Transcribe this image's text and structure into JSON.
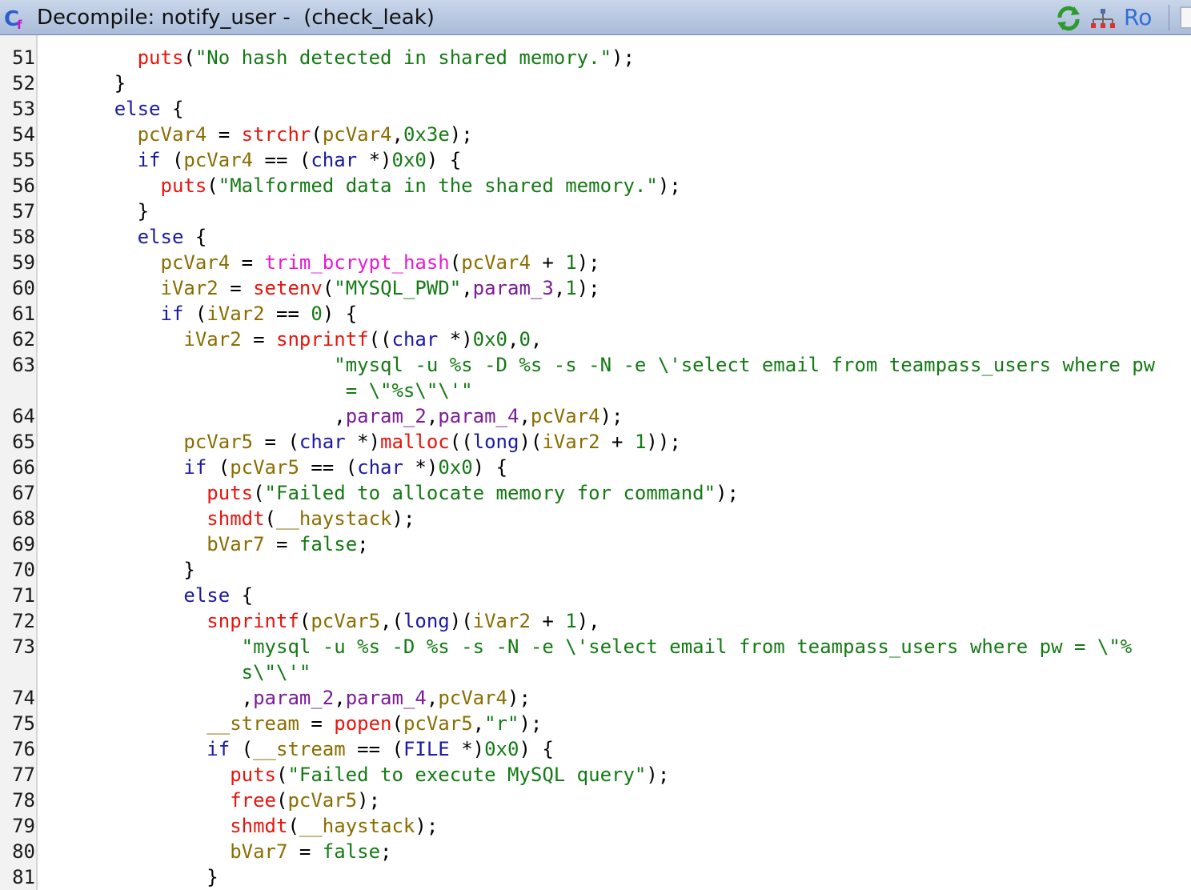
{
  "window": {
    "title": "Decompile: notify_user -  (check_leak)",
    "ro_label": "Ro",
    "icons": [
      "decompiler-app-icon",
      "refresh-icon",
      "graph-icon"
    ]
  },
  "colors": {
    "keyword": "#1a1aa6",
    "function_call": "#e8140c",
    "variable": "#8a6d00",
    "string": "#147a14",
    "number": "#147a14",
    "parameter": "#7b1c99",
    "special_function": "#e81ad0",
    "plain": "#000000"
  },
  "code_lines": [
    {
      "n": "51",
      "i": 4,
      "t": [
        [
          "f",
          "puts"
        ],
        [
          "p",
          "("
        ],
        [
          "s",
          "\"No hash detected in shared memory.\""
        ],
        [
          "p",
          ");"
        ]
      ]
    },
    {
      "n": "52",
      "i": 3,
      "t": [
        [
          "p",
          "}"
        ]
      ]
    },
    {
      "n": "53",
      "i": 3,
      "t": [
        [
          "k",
          "else"
        ],
        [
          "p",
          " {"
        ]
      ]
    },
    {
      "n": "54",
      "i": 4,
      "t": [
        [
          "v",
          "pcVar4"
        ],
        [
          "p",
          " = "
        ],
        [
          "f",
          "strchr"
        ],
        [
          "p",
          "("
        ],
        [
          "v",
          "pcVar4"
        ],
        [
          "p",
          ","
        ],
        [
          "num",
          "0x3e"
        ],
        [
          "p",
          ");"
        ]
      ]
    },
    {
      "n": "55",
      "i": 4,
      "t": [
        [
          "k",
          "if"
        ],
        [
          "p",
          " ("
        ],
        [
          "v",
          "pcVar4"
        ],
        [
          "p",
          " == ("
        ],
        [
          "k",
          "char"
        ],
        [
          "p",
          " *)"
        ],
        [
          "num",
          "0x0"
        ],
        [
          "p",
          ") {"
        ]
      ]
    },
    {
      "n": "56",
      "i": 5,
      "t": [
        [
          "f",
          "puts"
        ],
        [
          "p",
          "("
        ],
        [
          "s",
          "\"Malformed data in the shared memory.\""
        ],
        [
          "p",
          ");"
        ]
      ]
    },
    {
      "n": "57",
      "i": 4,
      "t": [
        [
          "p",
          "}"
        ]
      ]
    },
    {
      "n": "58",
      "i": 4,
      "t": [
        [
          "k",
          "else"
        ],
        [
          "p",
          " {"
        ]
      ]
    },
    {
      "n": "59",
      "i": 5,
      "t": [
        [
          "v",
          "pcVar4"
        ],
        [
          "p",
          " = "
        ],
        [
          "m",
          "trim_bcrypt_hash"
        ],
        [
          "p",
          "("
        ],
        [
          "v",
          "pcVar4"
        ],
        [
          "p",
          " + "
        ],
        [
          "num",
          "1"
        ],
        [
          "p",
          ");"
        ]
      ]
    },
    {
      "n": "60",
      "i": 5,
      "t": [
        [
          "v",
          "iVar2"
        ],
        [
          "p",
          " = "
        ],
        [
          "f",
          "setenv"
        ],
        [
          "p",
          "("
        ],
        [
          "s",
          "\"MYSQL_PWD\""
        ],
        [
          "p",
          ","
        ],
        [
          "a",
          "param_3"
        ],
        [
          "p",
          ","
        ],
        [
          "num",
          "1"
        ],
        [
          "p",
          ");"
        ]
      ]
    },
    {
      "n": "61",
      "i": 5,
      "t": [
        [
          "k",
          "if"
        ],
        [
          "p",
          " ("
        ],
        [
          "v",
          "iVar2"
        ],
        [
          "p",
          " == "
        ],
        [
          "num",
          "0"
        ],
        [
          "p",
          ") {"
        ]
      ]
    },
    {
      "n": "62",
      "i": 6,
      "t": [
        [
          "v",
          "iVar2"
        ],
        [
          "p",
          " = "
        ],
        [
          "f",
          "snprintf"
        ],
        [
          "p",
          "(("
        ],
        [
          "k",
          "char"
        ],
        [
          "p",
          " *)"
        ],
        [
          "num",
          "0x0"
        ],
        [
          "p",
          ","
        ],
        [
          "num",
          "0"
        ],
        [
          "p",
          ","
        ]
      ]
    },
    {
      "n": "63",
      "i": 0,
      "pad": "                         ",
      "t": [
        [
          "s",
          "\"mysql -u %s -D %s -s -N -e \\'select email from teampass_users where pw"
        ]
      ]
    },
    {
      "n": "",
      "i": 0,
      "pad": "                          ",
      "t": [
        [
          "s",
          "= \\\"%s\\\"\\'\""
        ]
      ]
    },
    {
      "n": "64",
      "i": 0,
      "pad": "                         ",
      "t": [
        [
          "p",
          ","
        ],
        [
          "a",
          "param_2"
        ],
        [
          "p",
          ","
        ],
        [
          "a",
          "param_4"
        ],
        [
          "p",
          ","
        ],
        [
          "v",
          "pcVar4"
        ],
        [
          "p",
          ");"
        ]
      ]
    },
    {
      "n": "65",
      "i": 6,
      "t": [
        [
          "v",
          "pcVar5"
        ],
        [
          "p",
          " = ("
        ],
        [
          "k",
          "char"
        ],
        [
          "p",
          " *)"
        ],
        [
          "f",
          "malloc"
        ],
        [
          "p",
          "(("
        ],
        [
          "k",
          "long"
        ],
        [
          "p",
          ")("
        ],
        [
          "v",
          "iVar2"
        ],
        [
          "p",
          " + "
        ],
        [
          "num",
          "1"
        ],
        [
          "p",
          "));"
        ]
      ]
    },
    {
      "n": "66",
      "i": 6,
      "t": [
        [
          "k",
          "if"
        ],
        [
          "p",
          " ("
        ],
        [
          "v",
          "pcVar5"
        ],
        [
          "p",
          " == ("
        ],
        [
          "k",
          "char"
        ],
        [
          "p",
          " *)"
        ],
        [
          "num",
          "0x0"
        ],
        [
          "p",
          ") {"
        ]
      ]
    },
    {
      "n": "67",
      "i": 7,
      "t": [
        [
          "f",
          "puts"
        ],
        [
          "p",
          "("
        ],
        [
          "s",
          "\"Failed to allocate memory for command\""
        ],
        [
          "p",
          ");"
        ]
      ]
    },
    {
      "n": "68",
      "i": 7,
      "t": [
        [
          "f",
          "shmdt"
        ],
        [
          "p",
          "("
        ],
        [
          "v",
          "__haystack"
        ],
        [
          "p",
          ");"
        ]
      ]
    },
    {
      "n": "69",
      "i": 7,
      "t": [
        [
          "v",
          "bVar7"
        ],
        [
          "p",
          " = "
        ],
        [
          "num",
          "false"
        ],
        [
          "p",
          ";"
        ]
      ]
    },
    {
      "n": "70",
      "i": 6,
      "t": [
        [
          "p",
          "}"
        ]
      ]
    },
    {
      "n": "71",
      "i": 6,
      "t": [
        [
          "k",
          "else"
        ],
        [
          "p",
          " {"
        ]
      ]
    },
    {
      "n": "72",
      "i": 7,
      "t": [
        [
          "f",
          "snprintf"
        ],
        [
          "p",
          "("
        ],
        [
          "v",
          "pcVar5"
        ],
        [
          "p",
          ",("
        ],
        [
          "k",
          "long"
        ],
        [
          "p",
          ")("
        ],
        [
          "v",
          "iVar2"
        ],
        [
          "p",
          " + "
        ],
        [
          "num",
          "1"
        ],
        [
          "p",
          "),"
        ]
      ]
    },
    {
      "n": "73",
      "i": 0,
      "pad": "                 ",
      "t": [
        [
          "s",
          "\"mysql -u %s -D %s -s -N -e \\'select email from teampass_users where pw = \\\"%"
        ]
      ]
    },
    {
      "n": "",
      "i": 0,
      "pad": "                 ",
      "t": [
        [
          "s",
          "s\\\"\\'\""
        ]
      ]
    },
    {
      "n": "74",
      "i": 0,
      "pad": "                 ",
      "t": [
        [
          "p",
          ","
        ],
        [
          "a",
          "param_2"
        ],
        [
          "p",
          ","
        ],
        [
          "a",
          "param_4"
        ],
        [
          "p",
          ","
        ],
        [
          "v",
          "pcVar4"
        ],
        [
          "p",
          ");"
        ]
      ]
    },
    {
      "n": "75",
      "i": 7,
      "t": [
        [
          "v",
          "__stream"
        ],
        [
          "p",
          " = "
        ],
        [
          "f",
          "popen"
        ],
        [
          "p",
          "("
        ],
        [
          "v",
          "pcVar5"
        ],
        [
          "p",
          ","
        ],
        [
          "s",
          "\"r\""
        ],
        [
          "p",
          ");"
        ]
      ]
    },
    {
      "n": "76",
      "i": 7,
      "t": [
        [
          "k",
          "if"
        ],
        [
          "p",
          " ("
        ],
        [
          "v",
          "__stream"
        ],
        [
          "p",
          " == ("
        ],
        [
          "k",
          "FILE"
        ],
        [
          "p",
          " *)"
        ],
        [
          "num",
          "0x0"
        ],
        [
          "p",
          ") {"
        ]
      ]
    },
    {
      "n": "77",
      "i": 8,
      "t": [
        [
          "f",
          "puts"
        ],
        [
          "p",
          "("
        ],
        [
          "s",
          "\"Failed to execute MySQL query\""
        ],
        [
          "p",
          ");"
        ]
      ]
    },
    {
      "n": "78",
      "i": 8,
      "t": [
        [
          "f",
          "free"
        ],
        [
          "p",
          "("
        ],
        [
          "v",
          "pcVar5"
        ],
        [
          "p",
          ");"
        ]
      ]
    },
    {
      "n": "79",
      "i": 8,
      "t": [
        [
          "f",
          "shmdt"
        ],
        [
          "p",
          "("
        ],
        [
          "v",
          "__haystack"
        ],
        [
          "p",
          ");"
        ]
      ]
    },
    {
      "n": "80",
      "i": 8,
      "t": [
        [
          "v",
          "bVar7"
        ],
        [
          "p",
          " = "
        ],
        [
          "num",
          "false"
        ],
        [
          "p",
          ";"
        ]
      ]
    },
    {
      "n": "81",
      "i": 7,
      "t": [
        [
          "p",
          "}"
        ]
      ]
    }
  ]
}
